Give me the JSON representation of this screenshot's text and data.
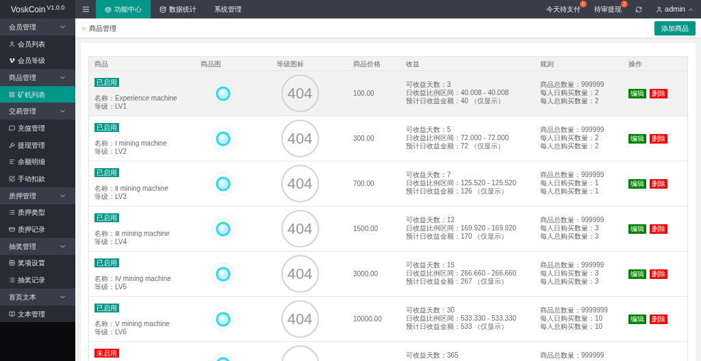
{
  "app": {
    "name": "VoskCoin",
    "version": "V1.0.0"
  },
  "top_nav": [
    {
      "label": "功能中心",
      "selected": true
    },
    {
      "label": "数据统计",
      "selected": false
    },
    {
      "label": "系统管理",
      "selected": false
    }
  ],
  "top_right": [
    {
      "label": "今天待支付",
      "badge": "0"
    },
    {
      "label": "待审提现",
      "badge": "2"
    }
  ],
  "user": "admin",
  "sidebar": [
    {
      "label": "会员管理",
      "expanded": true,
      "children": [
        {
          "label": "会员列表",
          "selected": false
        },
        {
          "label": "会员等级",
          "selected": false
        }
      ]
    },
    {
      "label": "商品管理",
      "expanded": true,
      "children": [
        {
          "label": "矿机列表",
          "selected": true
        }
      ]
    },
    {
      "label": "交易管理",
      "expanded": true,
      "children": [
        {
          "label": "充值管理",
          "selected": false
        },
        {
          "label": "提现管理",
          "selected": false
        },
        {
          "label": "余额明细",
          "selected": false
        },
        {
          "label": "手动扣款",
          "selected": false
        }
      ]
    },
    {
      "label": "质押管理",
      "expanded": true,
      "children": [
        {
          "label": "质押类型",
          "selected": false
        },
        {
          "label": "质押记录",
          "selected": false
        }
      ]
    },
    {
      "label": "抽奖管理",
      "expanded": true,
      "children": [
        {
          "label": "奖项设置",
          "selected": false
        },
        {
          "label": "抽奖记录",
          "selected": false
        }
      ]
    },
    {
      "label": "首页文本",
      "expanded": true,
      "children": [
        {
          "label": "文本管理",
          "selected": false
        }
      ]
    }
  ],
  "breadcrumb": "商品管理",
  "add_button": "添加商品",
  "table": {
    "columns": [
      "商品",
      "商品图",
      "等级图标",
      "商品价格",
      "收益",
      "规则",
      "操作"
    ],
    "rows": [
      {
        "highlighted": true,
        "status": {
          "label": "已启用",
          "enabled": true
        },
        "name": "名称：Experience machine",
        "level": "等级：LV1",
        "level_icon": "404",
        "price": "100.00",
        "income": [
          "可收益天数：3",
          "日收益比例区间：40.008 - 40.008",
          "预计日收益金额：40 （仅显示）"
        ],
        "rules": [
          "商品总数量：999999",
          "每人日购买数量：2",
          "每人总购买数量：2"
        ],
        "actions": [
          "编辑",
          "删除"
        ]
      },
      {
        "highlighted": false,
        "status": {
          "label": "已启用",
          "enabled": true
        },
        "name": "名称：Ⅰ mining machine",
        "level": "等级：LV2",
        "level_icon": "404",
        "price": "300.00",
        "income": [
          "可收益天数：5",
          "日收益比例区间：72.000 - 72.000",
          "预计日收益金额：72 （仅显示）"
        ],
        "rules": [
          "商品总数量：999999",
          "每人日购买数量：2",
          "每人总购买数量：2"
        ],
        "actions": [
          "编辑",
          "删除"
        ]
      },
      {
        "highlighted": false,
        "status": {
          "label": "已启用",
          "enabled": true
        },
        "name": "名称：Ⅱ mining machine",
        "level": "等级：LV3",
        "level_icon": "404",
        "price": "700.00",
        "income": [
          "可收益天数：7",
          "日收益比例区间：125.520 - 125.520",
          "预计日收益金额：126 （仅显示）"
        ],
        "rules": [
          "商品总数量：999999",
          "每人日购买数量：1",
          "每人总购买数量：1"
        ],
        "actions": [
          "编辑",
          "删除"
        ]
      },
      {
        "highlighted": false,
        "status": {
          "label": "已启用",
          "enabled": true
        },
        "name": "名称：Ⅲ mining machine",
        "level": "等级：LV4",
        "level_icon": "404",
        "price": "1500.00",
        "income": [
          "可收益天数：12",
          "日收益比例区间：169.920 - 169.920",
          "预计日收益金额：170 （仅显示）"
        ],
        "rules": [
          "商品总数量：999999",
          "每人日购买数量：3",
          "每人总购买数量：3"
        ],
        "actions": [
          "编辑",
          "删除"
        ]
      },
      {
        "highlighted": false,
        "status": {
          "label": "已启用",
          "enabled": true
        },
        "name": "名称：Ⅳ mining machine",
        "level": "等级：LV5",
        "level_icon": "404",
        "price": "3000.00",
        "income": [
          "可收益天数：15",
          "日收益比例区间：266.660 - 266.660",
          "预计日收益金额：267 （仅显示）"
        ],
        "rules": [
          "商品总数量：999999",
          "每人日购买数量：3",
          "每人总购买数量：3"
        ],
        "actions": [
          "编辑",
          "删除"
        ]
      },
      {
        "highlighted": false,
        "status": {
          "label": "已启用",
          "enabled": true
        },
        "name": "名称：Ⅴ mining machine",
        "level": "等级：LV6",
        "level_icon": "404",
        "price": "10000.00",
        "income": [
          "可收益天数：30",
          "日收益比例区间：533.330 - 533.330",
          "预计日收益金额：533 （仅显示）"
        ],
        "rules": [
          "商品总数量：9999999",
          "每人日购买数量：10",
          "每人总购买数量：10"
        ],
        "actions": [
          "编辑",
          "删除"
        ]
      },
      {
        "highlighted": false,
        "status": {
          "label": "未启用",
          "enabled": false
        },
        "income": [
          "可收益天数：365"
        ],
        "rules": [
          "商品总数量：999999"
        ]
      }
    ]
  }
}
